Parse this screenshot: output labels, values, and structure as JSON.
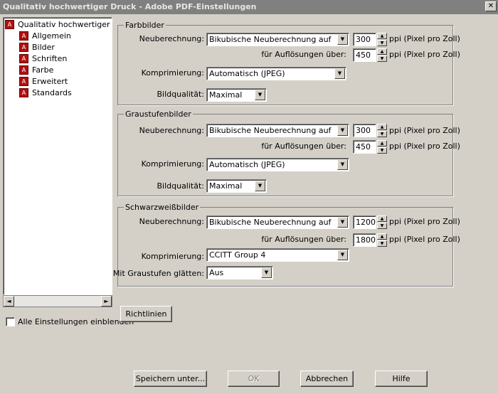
{
  "window": {
    "title": "Qualitativ hochwertiger Druck - Adobe PDF-Einstellungen",
    "close_glyph": "✕"
  },
  "tree": {
    "root": "Qualitativ hochwertiger Druck",
    "items": [
      "Allgemein",
      "Bilder",
      "Schriften",
      "Farbe",
      "Erweitert",
      "Standards"
    ]
  },
  "scroll": {
    "left": "◄",
    "right": "►"
  },
  "show_all": {
    "label": "Alle Einstellungen einblenden",
    "checked": false
  },
  "color_images": {
    "legend": "Farbbilder",
    "resample_label": "Neuberechnung:",
    "resample_value": "Bikubische Neuberechnung auf",
    "resample_ppi": "300",
    "above_label": "für Auflösungen über:",
    "above_ppi": "450",
    "compression_label": "Komprimierung:",
    "compression_value": "Automatisch (JPEG)",
    "quality_label": "Bildqualität:",
    "quality_value": "Maximal"
  },
  "gray_images": {
    "legend": "Graustufenbilder",
    "resample_label": "Neuberechnung:",
    "resample_value": "Bikubische Neuberechnung auf",
    "resample_ppi": "300",
    "above_label": "für Auflösungen über:",
    "above_ppi": "450",
    "compression_label": "Komprimierung:",
    "compression_value": "Automatisch (JPEG)",
    "quality_label": "Bildqualität:",
    "quality_value": "Maximal"
  },
  "mono_images": {
    "legend": "Schwarzweißbilder",
    "resample_label": "Neuberechnung:",
    "resample_value": "Bikubische Neuberechnung auf",
    "resample_ppi": "1200",
    "above_label": "für Auflösungen über:",
    "above_ppi": "1800",
    "compression_label": "Komprimierung:",
    "compression_value": "CCITT Group 4",
    "smooth_label": "Mit Graustufen glätten:",
    "smooth_value": "Aus"
  },
  "units": {
    "ppi": "ppi (Pixel pro Zoll)"
  },
  "buttons": {
    "guidelines": "Richtlinien",
    "save_as": "Speichern unter...",
    "ok": "OK",
    "cancel": "Abbrechen",
    "help": "Hilfe"
  }
}
